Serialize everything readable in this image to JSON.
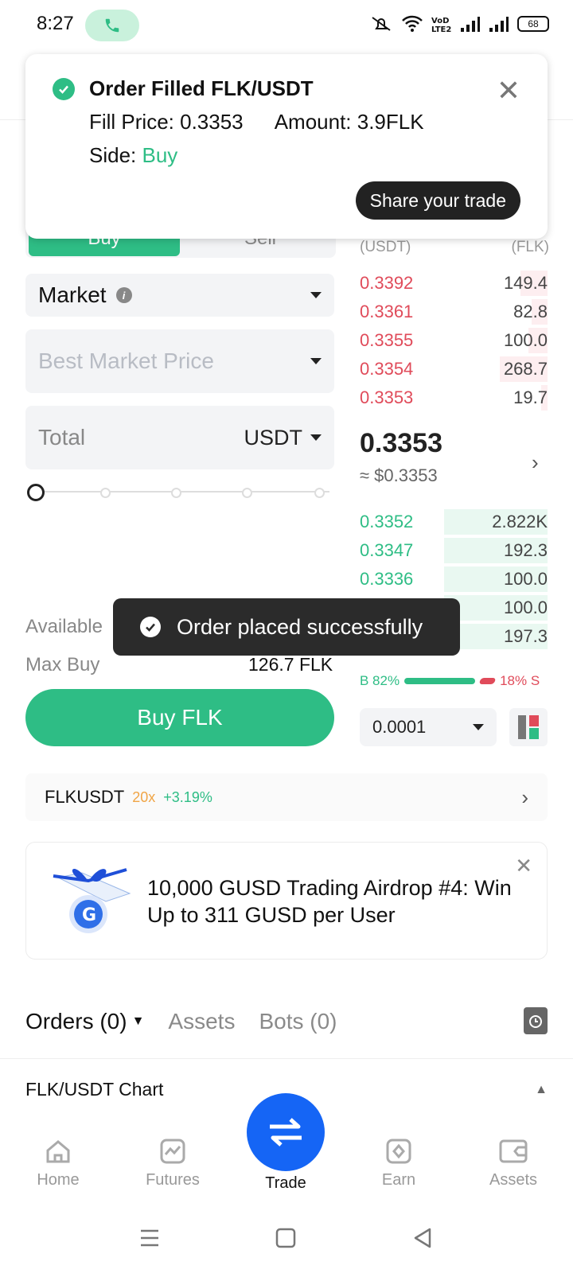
{
  "status_bar": {
    "time": "8:27",
    "battery": "68"
  },
  "trade_form": {
    "buy_tab": "Buy",
    "sell_tab": "Sell",
    "order_type": "Market",
    "price_placeholder": "Best Market Price",
    "total_label": "Total",
    "total_currency": "USDT",
    "available_label": "Available",
    "max_buy_label": "Max Buy",
    "max_buy_value": "126.7 FLK",
    "buy_button": "Buy FLK"
  },
  "order_book": {
    "price_header": "(USDT)",
    "amount_header": "(FLK)",
    "asks": [
      {
        "price": "0.3392",
        "amount": "149.4"
      },
      {
        "price": "0.3361",
        "amount": "82.8"
      },
      {
        "price": "0.3355",
        "amount": "100.0"
      },
      {
        "price": "0.3354",
        "amount": "268.7"
      },
      {
        "price": "0.3353",
        "amount": "19.7"
      }
    ],
    "last_price": "0.3353",
    "last_price_usd": "≈ $0.3353",
    "bids": [
      {
        "price": "0.3352",
        "amount": "2.822K"
      },
      {
        "price": "0.3347",
        "amount": "192.3"
      },
      {
        "price": "0.3336",
        "amount": "100.0"
      },
      {
        "price": "",
        "amount": "100.0"
      },
      {
        "price": "",
        "amount": "197.3"
      }
    ],
    "buy_ratio_label": "B 82%",
    "sell_ratio_label": "18% S",
    "buy_ratio": 0.82,
    "tick_size": "0.0001"
  },
  "pair_bar": {
    "symbol": "FLKUSDT",
    "leverage": "20x",
    "change": "+3.19%"
  },
  "promo": {
    "text": "10,000 GUSD Trading Airdrop #4: Win Up to 311 GUSD per User"
  },
  "orders_tabs": {
    "orders": "Orders (0)",
    "assets": "Assets",
    "bots": "Bots (0)"
  },
  "chart_row": {
    "label": "FLK/USDT Chart"
  },
  "bottom_nav": {
    "home": "Home",
    "futures": "Futures",
    "trade": "Trade",
    "earn": "Earn",
    "assets": "Assets"
  },
  "notification": {
    "title": "Order Filled FLK/USDT",
    "fill_price": "Fill Price: 0.3353",
    "amount": "Amount: 3.9FLK",
    "side_label": "Side: ",
    "side_value": "Buy",
    "share_button": "Share your trade"
  },
  "toast": {
    "message": "Order placed successfully"
  },
  "colors": {
    "green": "#2ebd85",
    "red": "#e04b5a",
    "blue": "#1565f5"
  }
}
